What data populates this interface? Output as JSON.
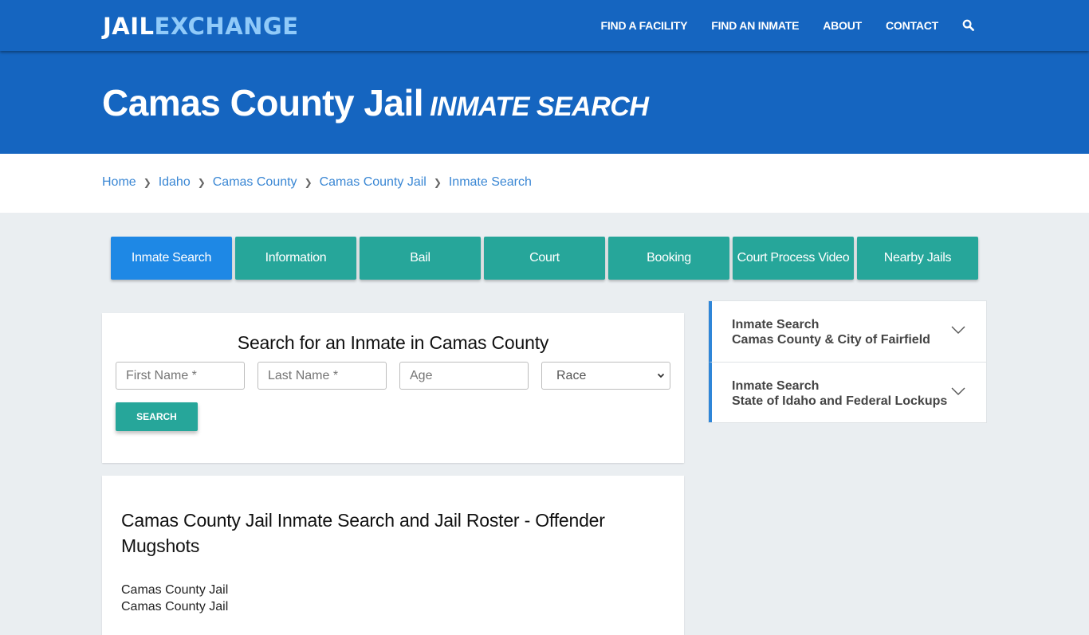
{
  "header": {
    "logo_part1": "JAIL",
    "logo_part2": "EXCHANGE",
    "nav": [
      {
        "label": "FIND A FACILITY"
      },
      {
        "label": "FIND AN INMATE"
      },
      {
        "label": "ABOUT"
      },
      {
        "label": "CONTACT"
      }
    ],
    "search_icon": "search-icon"
  },
  "hero": {
    "title": "Camas County Jail",
    "subtitle": "INMATE SEARCH"
  },
  "breadcrumb": [
    {
      "label": "Home"
    },
    {
      "label": "Idaho"
    },
    {
      "label": "Camas County"
    },
    {
      "label": "Camas County Jail"
    },
    {
      "label": "Inmate Search"
    }
  ],
  "tabs": [
    {
      "label": "Inmate Search",
      "active": true
    },
    {
      "label": "Information"
    },
    {
      "label": "Bail"
    },
    {
      "label": "Court"
    },
    {
      "label": "Booking"
    },
    {
      "label": "Court Process Video"
    },
    {
      "label": "Nearby Jails"
    }
  ],
  "search_form": {
    "title": "Search for an Inmate in Camas County",
    "first_name_placeholder": "First Name *",
    "last_name_placeholder": "Last Name *",
    "age_placeholder": "Age",
    "race_selected": "Race",
    "submit_label": "SEARCH"
  },
  "article": {
    "heading": "Camas County Jail Inmate Search and Jail Roster - Offender Mugshots",
    "lines": [
      "Camas County Jail",
      "Camas County Jail"
    ]
  },
  "sidebar": {
    "items": [
      {
        "title": "Inmate Search",
        "subtitle": "Camas County & City of Fairfield"
      },
      {
        "title": "Inmate Search",
        "subtitle": "State of Idaho and Federal Lockups"
      }
    ]
  },
  "colors": {
    "brand_blue": "#1565c0",
    "logo_accent": "#90caf9",
    "tab_teal": "#26a69a",
    "tab_active": "#1e88e5",
    "link_blue": "#3a87d4",
    "accordion_accent": "#2f86d8"
  }
}
